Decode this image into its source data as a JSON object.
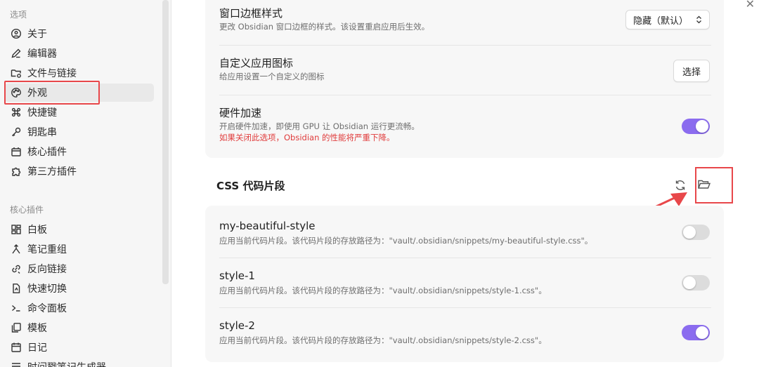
{
  "sidebar": {
    "options_title": "选项",
    "options": [
      {
        "label": "关于",
        "icon": "info-icon"
      },
      {
        "label": "编辑器",
        "icon": "pencil-icon"
      },
      {
        "label": "文件与链接",
        "icon": "folder-link-icon"
      },
      {
        "label": "外观",
        "icon": "palette-icon",
        "active": true
      },
      {
        "label": "快捷键",
        "icon": "command-icon"
      },
      {
        "label": "钥匙串",
        "icon": "key-icon"
      },
      {
        "label": "核心插件",
        "icon": "plugin-icon"
      },
      {
        "label": "第三方插件",
        "icon": "puzzle-icon"
      }
    ],
    "core_title": "核心插件",
    "core_plugins": [
      {
        "label": "白板",
        "icon": "canvas-icon"
      },
      {
        "label": "笔记重组",
        "icon": "merge-icon"
      },
      {
        "label": "反向链接",
        "icon": "backlink-icon"
      },
      {
        "label": "快速切换",
        "icon": "switch-icon"
      },
      {
        "label": "命令面板",
        "icon": "terminal-icon"
      },
      {
        "label": "模板",
        "icon": "template-icon"
      },
      {
        "label": "日记",
        "icon": "calendar-icon"
      },
      {
        "label": "时间戳笔记生成器",
        "icon": "stamp-icon"
      }
    ]
  },
  "appearance": {
    "frame": {
      "title": "窗口边框样式",
      "desc": "更改 Obsidian 窗口边框的样式。该设置重启应用后生效。",
      "value": "隐藏（默认）"
    },
    "custom_icon": {
      "title": "自定义应用图标",
      "desc": "给应用设置一个自定义的图标",
      "button": "选择"
    },
    "hw_accel": {
      "title": "硬件加速",
      "desc": "开启硬件加速，即使用 GPU 让 Obsidian 运行更流畅。",
      "warning": "如果关闭此选项，Obsidian 的性能将严重下降。",
      "enabled": true
    }
  },
  "css_snippets": {
    "heading": "CSS 代码片段",
    "items": [
      {
        "name": "my-beautiful-style",
        "desc": "应用当前代码片段。该代码片段的存放路径为：\"vault/.obsidian/snippets/my-beautiful-style.css\"。",
        "enabled": false
      },
      {
        "name": "style-1",
        "desc": "应用当前代码片段。该代码片段的存放路径为：\"vault/.obsidian/snippets/style-1.css\"。",
        "enabled": false
      },
      {
        "name": "style-2",
        "desc": "应用当前代码片段。该代码片段的存放路径为：\"vault/.obsidian/snippets/style-2.css\"。",
        "enabled": true
      }
    ]
  },
  "colors": {
    "accent": "#8b6cef",
    "annotation": "#e8474a",
    "warning": "#e03b3b"
  }
}
